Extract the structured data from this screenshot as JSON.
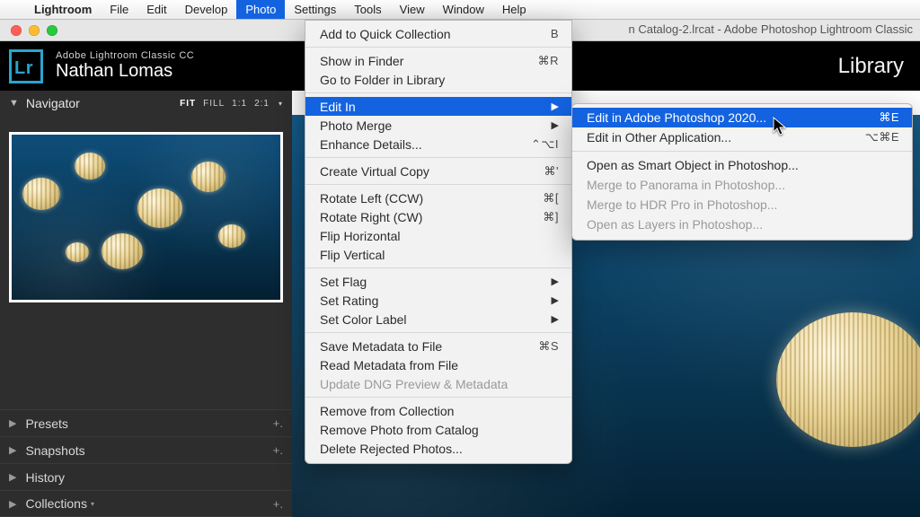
{
  "menubar": {
    "apple": "",
    "app": "Lightroom",
    "items": [
      "File",
      "Edit",
      "Develop",
      "Photo",
      "Settings",
      "Tools",
      "View",
      "Window",
      "Help"
    ],
    "active_index": 3
  },
  "window": {
    "title_fragment": "n Catalog-2.lrcat - Adobe Photoshop Lightroom Classic"
  },
  "identity": {
    "logo": "Lr",
    "line1": "Adobe Lightroom Classic CC",
    "line2": "Nathan Lomas",
    "module": "Library"
  },
  "navigator": {
    "title": "Navigator",
    "opts": [
      "FIT",
      "FILL",
      "1:1",
      "2:1"
    ],
    "active_opt": 0
  },
  "left_panels": [
    {
      "label": "Presets",
      "plus": "+."
    },
    {
      "label": "Snapshots",
      "plus": "+."
    },
    {
      "label": "History",
      "plus": ""
    },
    {
      "label": "Collections",
      "plus": "+."
    }
  ],
  "menu": {
    "groups": [
      [
        {
          "label": "Add to Quick Collection",
          "shortcut": "B"
        }
      ],
      [
        {
          "label": "Show in Finder",
          "shortcut": "⌘R"
        },
        {
          "label": "Go to Folder in Library",
          "shortcut": ""
        }
      ],
      [
        {
          "label": "Edit In",
          "submenu": true,
          "highlight": true
        },
        {
          "label": "Photo Merge",
          "submenu": true
        },
        {
          "label": "Enhance Details...",
          "shortcut": "⌃⌥I"
        }
      ],
      [
        {
          "label": "Create Virtual Copy",
          "shortcut": "⌘'"
        }
      ],
      [
        {
          "label": "Rotate Left (CCW)",
          "shortcut": "⌘["
        },
        {
          "label": "Rotate Right (CW)",
          "shortcut": "⌘]"
        },
        {
          "label": "Flip Horizontal",
          "shortcut": ""
        },
        {
          "label": "Flip Vertical",
          "shortcut": ""
        }
      ],
      [
        {
          "label": "Set Flag",
          "submenu": true
        },
        {
          "label": "Set Rating",
          "submenu": true
        },
        {
          "label": "Set Color Label",
          "submenu": true
        }
      ],
      [
        {
          "label": "Save Metadata to File",
          "shortcut": "⌘S"
        },
        {
          "label": "Read Metadata from File",
          "shortcut": ""
        },
        {
          "label": "Update DNG Preview & Metadata",
          "shortcut": "",
          "disabled": true
        }
      ],
      [
        {
          "label": "Remove from Collection",
          "shortcut": ""
        },
        {
          "label": "Remove Photo from Catalog",
          "shortcut": ""
        },
        {
          "label": "Delete Rejected Photos...",
          "shortcut": ""
        }
      ]
    ]
  },
  "submenu": {
    "groups": [
      [
        {
          "label": "Edit in Adobe Photoshop 2020...",
          "shortcut": "⌘E",
          "highlight": true
        },
        {
          "label": "Edit in Other Application...",
          "shortcut": "⌥⌘E"
        }
      ],
      [
        {
          "label": "Open as Smart Object in Photoshop..."
        },
        {
          "label": "Merge to Panorama in Photoshop...",
          "disabled": true
        },
        {
          "label": "Merge to HDR Pro in Photoshop...",
          "disabled": true
        },
        {
          "label": "Open as Layers in Photoshop...",
          "disabled": true
        }
      ]
    ]
  }
}
